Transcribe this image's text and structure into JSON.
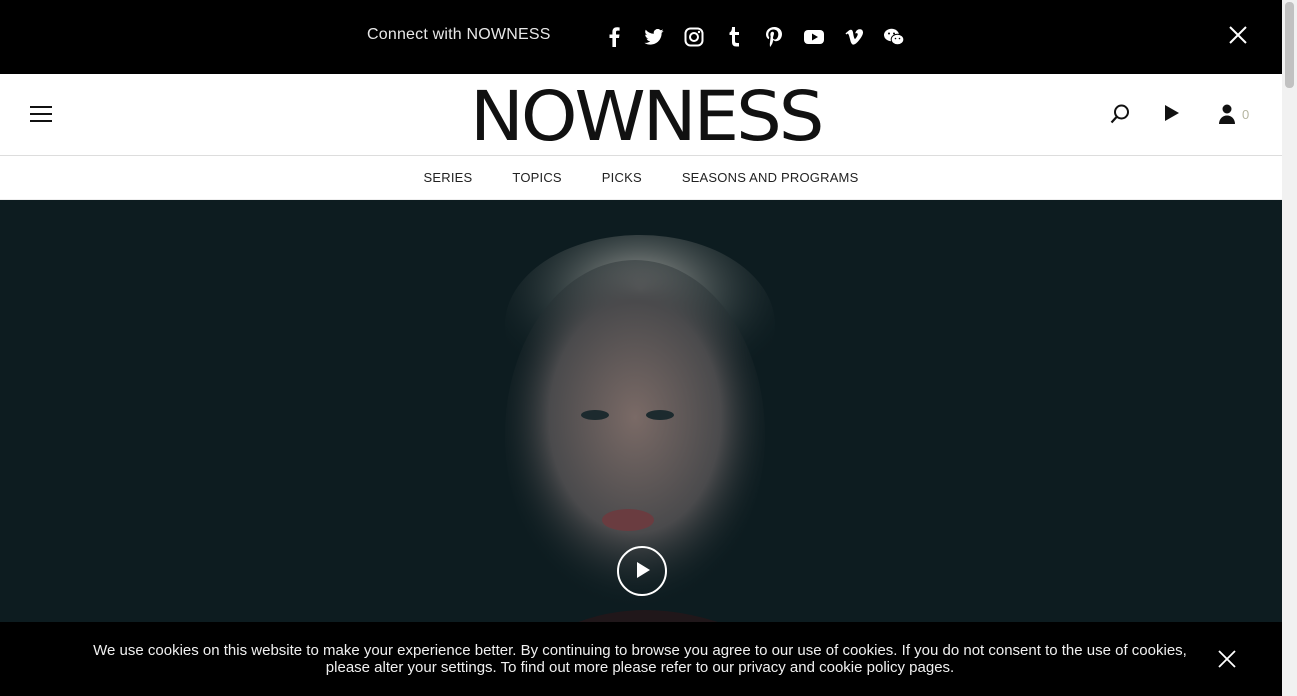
{
  "social_bar": {
    "connect_text": "Connect with NOWNESS",
    "icons": [
      "facebook-icon",
      "twitter-icon",
      "instagram-icon",
      "tumblr-icon",
      "pinterest-icon",
      "youtube-icon",
      "vimeo-icon",
      "wechat-icon"
    ]
  },
  "header": {
    "logo": "NOWNESS",
    "user_count": "0"
  },
  "nav": {
    "items": [
      "SERIES",
      "TOPICS",
      "PICKS",
      "SEASONS AND PROGRAMS"
    ]
  },
  "cookie": {
    "message": "We use cookies on this website to make your experience better. By continuing to browse you agree to our use of cookies. If you do not consent to the use of cookies, please alter your settings. To find out more please refer to our privacy and cookie policy pages."
  },
  "colors": {
    "bar_bg": "#000000",
    "hero_bg": "#0d1c20",
    "count": "#b5b5a0"
  }
}
